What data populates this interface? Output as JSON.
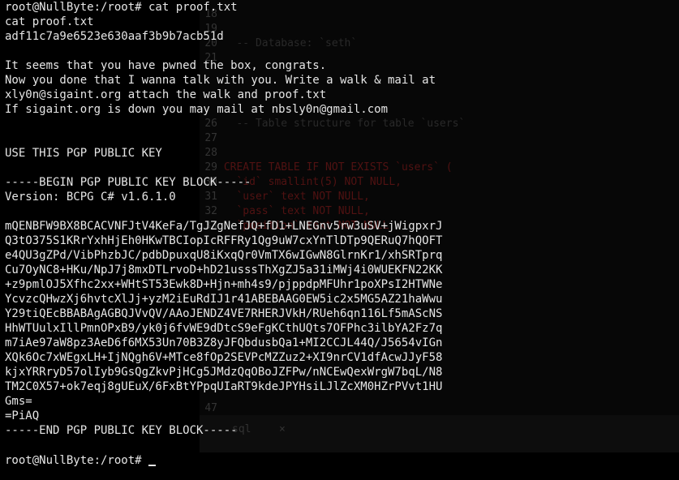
{
  "terminal": {
    "lines": [
      "root@NullByte:/root# cat proof.txt",
      "cat proof.txt",
      "adf11c7a9e6523e630aaf3b9b7acb51d",
      "",
      "It seems that you have pwned the box, congrats.",
      "Now you done that I wanna talk with you. Write a walk & mail at",
      "xly0n@sigaint.org attach the walk and proof.txt",
      "If sigaint.org is down you may mail at nbsly0n@gmail.com",
      "",
      "",
      "USE THIS PGP PUBLIC KEY",
      "",
      "-----BEGIN PGP PUBLIC KEY BLOCK-----",
      "Version: BCPG C# v1.6.1.0",
      "",
      "mQENBFW9BX8BCACVNFJtV4KeFa/TgJZgNefJQ+fD1+LNEGnv5rw3uSV+jWigpxrJ",
      "Q3tO375S1KRrYxhHjEh0HKwTBCIopIcRFFRy1Qg9uW7cxYnTlDTp9QERuQ7hQOFT",
      "e4QU3gZPd/VibPhzbJC/pdbDpuxqU8iKxqQr0VmTX6wIGwN8GlrnKr1/xhSRTprq",
      "Cu7OyNC8+HKu/NpJ7j8mxDTLrvoD+hD21usssThXgZJ5a31iMWj4i0WUEKFN22KK",
      "+z9pmlOJ5Xfhc2xx+WHtST53Ewk8D+Hjn+mh4s9/pjppdpMFUhr1poXPsI2HTWNe",
      "YcvzcQHwzXj6hvtcXlJj+yzM2iEuRdIJ1r41ABEBAAG0EW5ic2x5MG5AZ21haWwu",
      "Y29tiQEcBBABAgAGBQJVvQV/AAoJENDZ4VE7RHERJVkH/RUeh6qn116Lf5mAScNS",
      "HhWTUulxIllPmnOPxB9/yk0j6fvWE9dDtcS9eFgKCthUQts7OFPhc3ilbYA2Fz7q",
      "m7iAe97aW8pz3AeD6f6MX53Un70B3Z8yJFQbdusbQa1+MI2CCJL44Q/J5654vIGn",
      "XQk6Oc7xWEgxLH+IjNQgh6V+MTce8fOp2SEVPcMZZuz2+XI9nrCV1dfAcwJJyF58",
      "kjxYRRryD57olIyb9GsQgZkvPjHCg5JMdzQqOBoJZFPw/nNCEwQexWrgW7bqL/N8",
      "TM2C0X57+ok7eqj8gUEuX/6FxBtYPpqUIaRT9kdeJPYHsiLJlZcXM0HZrPVvt1HU",
      "Gms=",
      "=PiAQ",
      "-----END PGP PUBLIC KEY BLOCK-----",
      ""
    ],
    "prompt": "root@NullByte:/root# "
  },
  "background_editor": {
    "tab_label": "sql",
    "tab_close": "×",
    "lines": [
      {
        "num": "18",
        "text": ""
      },
      {
        "num": "19",
        "text": ""
      },
      {
        "num": "20",
        "text": "  -- Database: `seth`"
      },
      {
        "num": "21",
        "text": ""
      },
      {
        "num": "26",
        "text": "  -- Table structure for table `users`"
      },
      {
        "num": "27",
        "text": ""
      },
      {
        "num": "28",
        "text": ""
      },
      {
        "num": "29",
        "text": "CREATE TABLE IF NOT EXISTS `users` ("
      },
      {
        "num": "30",
        "text": "  `id` smallint(5) NOT NULL,"
      },
      {
        "num": "31",
        "text": "  `user` text NOT NULL,"
      },
      {
        "num": "32",
        "text": "  `pass` text NOT NULL,"
      },
      {
        "num": "33",
        "text": "  `position` text NOT NULL"
      },
      {
        "num": "47",
        "text": ""
      }
    ]
  }
}
